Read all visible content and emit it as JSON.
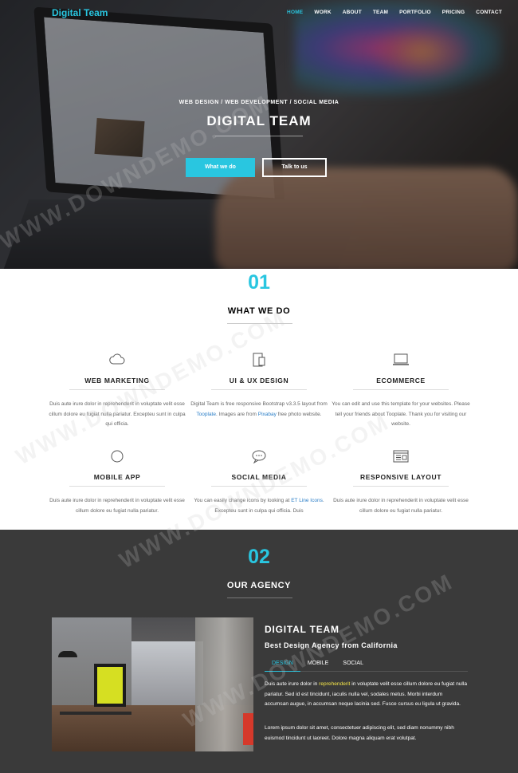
{
  "nav": {
    "brand": "Digital Team",
    "links": [
      "HOME",
      "WORK",
      "ABOUT",
      "TEAM",
      "PORTFOLIO",
      "PRICING",
      "CONTACT"
    ]
  },
  "hero": {
    "subtitle": "WEB DESIGN / WEB DEVELOPMENT / SOCIAL MEDIA",
    "title": "DIGITAL TEAM",
    "primary_button": "What we do",
    "secondary_button": "Talk to us"
  },
  "services_section": {
    "number": "01",
    "title": "WHAT WE DO",
    "items": [
      {
        "icon": "cloud-icon",
        "name": "WEB MARKETING",
        "desc": "Duis aute irure dolor in reprehenderit in voluptate velit esse cillum dolore eu fugiat nulla pariatur. Excepteu sunt in culpa qui officia."
      },
      {
        "icon": "mobile-icon",
        "name": "UI & UX DESIGN",
        "desc_pre": "Digital Team is free responsive Bootstrap v3.3.5 layout from ",
        "desc_link1": "Tooplate",
        "desc_mid": ". Images are from ",
        "desc_link2": "Pixabay",
        "desc_post": " free photo website."
      },
      {
        "icon": "laptop-icon",
        "name": "ECOMMERCE",
        "desc": "You can edit and use this template for your websites. Please tell your friends about Tooplate. Thank you for visiting our website."
      },
      {
        "icon": "compass-icon",
        "name": "MOBILE APP",
        "desc": "Duis aute irure dolor in reprehenderit in voluptate velit esse cillum dolore eu fugiat nulla pariatur."
      },
      {
        "icon": "chat-icon",
        "name": "SOCIAL MEDIA",
        "desc_pre": "You can easily change icons by looking at ",
        "desc_link1": "ET Line Icons",
        "desc_post": ". Excepteu sunt in culpa qui officia. Duis"
      },
      {
        "icon": "layout-icon",
        "name": "RESPONSIVE LAYOUT",
        "desc": "Duis aute irure dolor in reprehenderit in voluptate velit esse cillum dolore eu fugiat nulla pariatur."
      }
    ]
  },
  "agency_section": {
    "number": "02",
    "title": "OUR AGENCY",
    "heading": "DIGITAL TEAM",
    "subheading": "Best Design Agency from California",
    "tabs": [
      "DESIGN",
      "MOBILE",
      "SOCIAL"
    ],
    "para1_pre": "Duis aute irure dolor in ",
    "para1_hl": "reprehenderit",
    "para1_post": " in voluptate velit esse cillum dolore eu fugiat nulla pariatur. Sed id est tincidunt, iaculis nulla vel, sodales metus. Morbi interdum accumsan augue, in accumsan neque lacinia sed. Fusce cursus eu ligula ut gravida.",
    "para2": "Lorem ipsum dolor sit amet, consectetuer adipiscing elit, sed diam nonummy nibh euismod tincidunt ut laoreet. Dolore magna aliquam erat volutpat."
  },
  "watermark": "WWW.DOWNDEMO.COM",
  "colors": {
    "accent": "#29c6e0",
    "dark_bg": "#3a3a3a",
    "link": "#2a7ec7",
    "highlight": "#f5e64a"
  }
}
